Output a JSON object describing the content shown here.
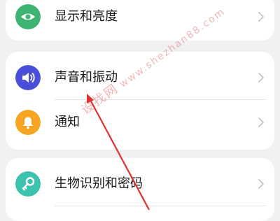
{
  "colors": {
    "background": "#f1f1f3",
    "card": "#ffffff",
    "display_icon": "#3cb371",
    "sound_icon": "#4a4fd8",
    "notification_icon": "#f5a623",
    "security_icon": "#3cc3b0",
    "arrow": "#e03030"
  },
  "settings": {
    "display": {
      "label": "显示和亮度",
      "icon": "eye-icon"
    },
    "sound": {
      "label": "声音和振动",
      "icon": "speaker-icon"
    },
    "notification": {
      "label": "通知",
      "icon": "bell-icon"
    },
    "security": {
      "label": "生物识别和密码",
      "icon": "key-icon"
    }
  },
  "watermark": {
    "cn": "设找网",
    "en": "www.shezhan88.com"
  }
}
